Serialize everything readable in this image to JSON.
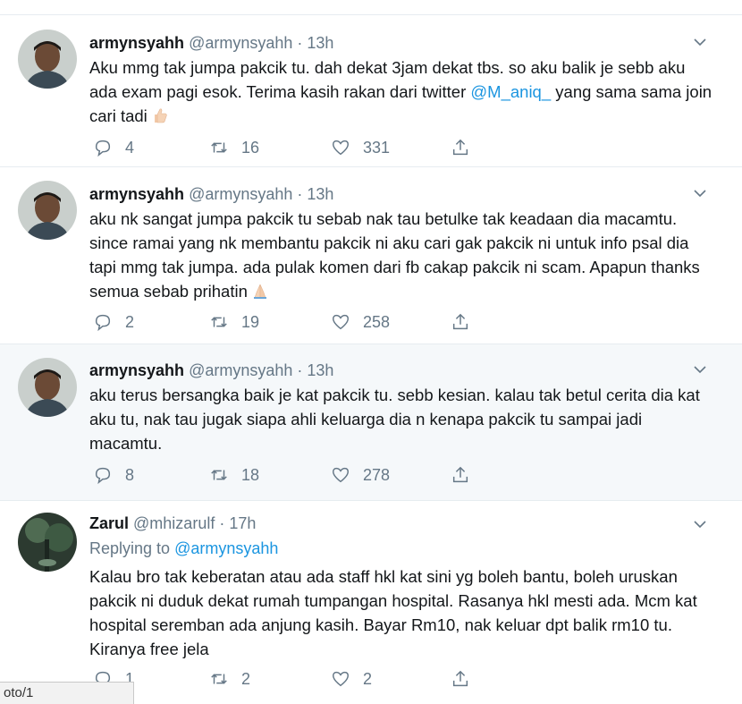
{
  "tweets": [
    {
      "name": "armynsyahh",
      "handle": "@armynsyahh · 13h",
      "text_before": "Aku mmg tak jumpa pakcik tu. dah dekat 3jam dekat tbs. so aku balik je sebb aku ada exam pagi esok. Terima kasih rakan dari twitter ",
      "mention": "@M_aniq_",
      "text_after": " yang sama sama join cari tadi",
      "emoji": "thumbs-up",
      "replies": "4",
      "retweets": "16",
      "likes": "331"
    },
    {
      "name": "armynsyahh",
      "handle": "@armynsyahh · 13h",
      "text": "aku nk sangat jumpa pakcik tu sebab nak tau betulke tak keadaan dia macamtu. since ramai yang nk membantu pakcik ni aku cari gak pakcik ni untuk info psal dia tapi mmg tak jumpa. ada pulak komen dari fb cakap pakcik ni scam. Apapun thanks semua sebab prihatin",
      "emoji": "folded-hands",
      "replies": "2",
      "retweets": "19",
      "likes": "258"
    },
    {
      "name": "armynsyahh",
      "handle": "@armynsyahh · 13h",
      "text": "aku terus bersangka baik je kat pakcik tu. sebb kesian. kalau tak betul cerita dia kat aku tu, nak tau jugak siapa ahli keluarga dia n kenapa pakcik tu sampai jadi macamtu.",
      "replies": "8",
      "retweets": "18",
      "likes": "278"
    },
    {
      "name": "Zarul",
      "handle": "@mhizarulf · 17h",
      "replying_label": "Replying to ",
      "replying_to": "@armynsyahh",
      "text": "Kalau bro tak keberatan atau ada staff hkl kat sini yg boleh bantu, boleh uruskan pakcik ni duduk dekat rumah tumpangan hospital. Rasanya hkl mesti ada. Mcm kat hospital seremban ada anjung kasih. Bayar Rm10, nak keluar dpt balik rm10 tu. Kiranya free jela",
      "replies": "1",
      "retweets": "2",
      "likes": "2"
    }
  ],
  "status_bar": {
    "url": "oto/1"
  },
  "colors": {
    "accent": "#1b95e0",
    "muted": "#657786",
    "highlight_bg": "#f5f8fa",
    "border": "#e6ecf0"
  },
  "icons": [
    "reply-icon",
    "retweet-icon",
    "like-icon",
    "share-icon",
    "chevron-down-icon"
  ]
}
